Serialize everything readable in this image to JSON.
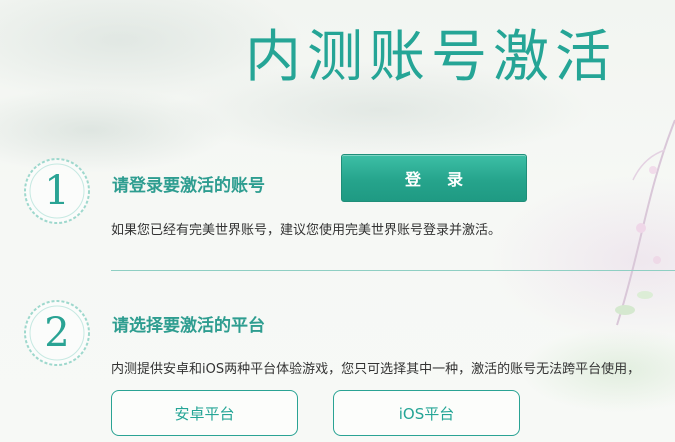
{
  "header": {
    "title": "内测账号激活"
  },
  "step1": {
    "number": "1",
    "heading": "请登录要激活的账号",
    "button_label": "登录",
    "description": "如果您已经有完美世界账号，建议您使用完美世界账号登录并激活。"
  },
  "step2": {
    "number": "2",
    "heading": "请选择要激活的平台",
    "description": "内测提供安卓和iOS两种平台体验游戏，您只可选择其中一种，激活的账号无法跨平台使用，",
    "platforms": [
      {
        "label": "安卓平台"
      },
      {
        "label": "iOS平台"
      }
    ]
  },
  "colors": {
    "accent": "#25a596",
    "button_green": "#26a48c",
    "divider": "#8fcfc3"
  }
}
